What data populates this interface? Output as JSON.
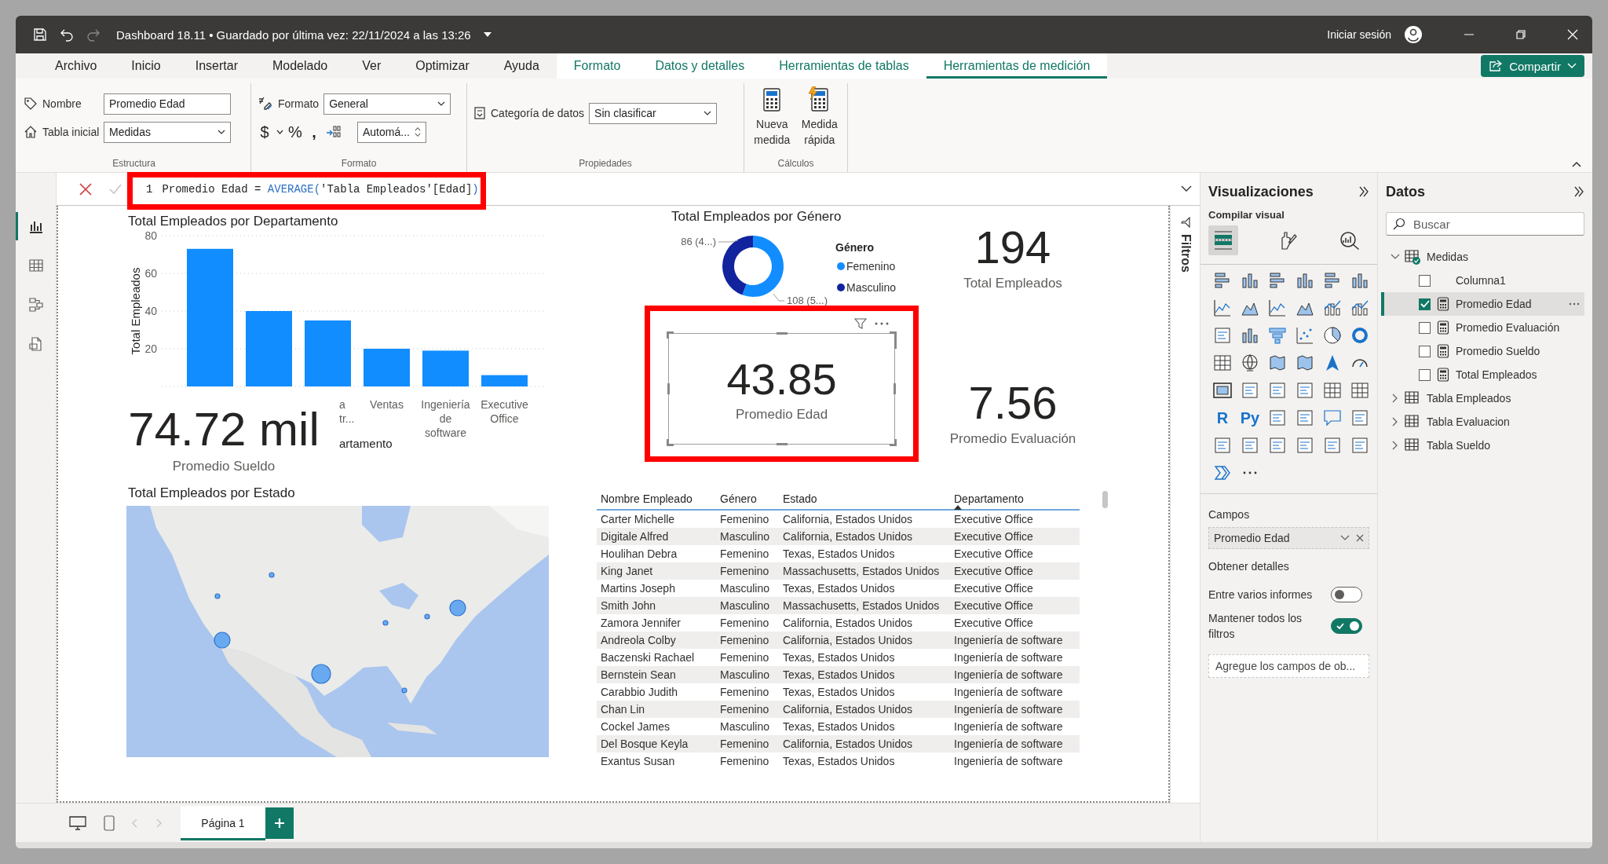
{
  "window": {
    "title": "Dashboard 18.11 • Guardado por última vez: 22/11/2024 a las 13:26",
    "sign_in": "Iniciar sesión"
  },
  "ribbon_tabs": [
    {
      "label": "Archivo",
      "contextual": false,
      "selected": false
    },
    {
      "label": "Inicio",
      "contextual": false,
      "selected": false
    },
    {
      "label": "Insertar",
      "contextual": false,
      "selected": false
    },
    {
      "label": "Modelado",
      "contextual": false,
      "selected": false
    },
    {
      "label": "Ver",
      "contextual": false,
      "selected": false
    },
    {
      "label": "Optimizar",
      "contextual": false,
      "selected": false
    },
    {
      "label": "Ayuda",
      "contextual": false,
      "selected": false
    },
    {
      "label": "Formato",
      "contextual": true,
      "selected": false
    },
    {
      "label": "Datos y detalles",
      "contextual": true,
      "selected": false
    },
    {
      "label": "Herramientas de tablas",
      "contextual": true,
      "selected": false
    },
    {
      "label": "Herramientas de medición",
      "contextual": true,
      "selected": true
    }
  ],
  "share_button": "Compartir",
  "ribbon": {
    "structure": {
      "group": "Estructura",
      "name_label": "Nombre",
      "name_value": "Promedio Edad",
      "home_table_label": "Tabla inicial",
      "home_table_value": "Medidas"
    },
    "formatting": {
      "group": "Formato",
      "format_label": "Formato",
      "format_value": "General",
      "symbols": [
        "$",
        "%",
        ","
      ],
      "decimals_value": "Automá..."
    },
    "properties": {
      "group": "Propiedades",
      "category_label": "Categoría de datos",
      "category_value": "Sin clasificar"
    },
    "calculations": {
      "group": "Cálculos",
      "buttons": [
        {
          "label": "Nueva medida",
          "kind": "new"
        },
        {
          "label": "Medida rápida",
          "kind": "quick"
        }
      ]
    }
  },
  "formula_bar": {
    "line_number": "1",
    "tokens": [
      {
        "text": "Promedio Edad = ",
        "kind": "plain"
      },
      {
        "text": "AVERAGE(",
        "kind": "function"
      },
      {
        "text": "'Tabla Empleados'[Edad]",
        "kind": "plain"
      },
      {
        "text": ")",
        "kind": "function"
      }
    ]
  },
  "left_rail": [
    {
      "kind": "report",
      "selected": true
    },
    {
      "kind": "table",
      "selected": false
    },
    {
      "kind": "model",
      "selected": false
    },
    {
      "kind": "dax",
      "selected": false
    }
  ],
  "report": {
    "bar_chart": {
      "chart_data": {
        "type": "bar",
        "title": "Total Empleados por Departamento",
        "xlabel": "artamento",
        "ylabel": "Total Empleados",
        "categories": [
          null,
          null,
          "a tr...",
          "Ventas",
          "Ingeniería de software",
          "Executive Office"
        ],
        "values": [
          73,
          40,
          35,
          20,
          19,
          6
        ],
        "ylim": [
          0,
          80
        ],
        "yticks": [
          20,
          40,
          60,
          80
        ],
        "grid": true,
        "color": "#118dff"
      }
    },
    "donut_chart": {
      "chart_data": {
        "type": "donut",
        "title": "Total Empleados por Género",
        "categories": [
          "Femenino",
          "Masculino"
        ],
        "colors": [
          "#118dff",
          "#12239e"
        ],
        "values": [
          108,
          86
        ],
        "value_labels": [
          "108 (5...)",
          "86 (4...)"
        ],
        "legend": {
          "title": "Género"
        }
      }
    },
    "cards": [
      {
        "value": "74.72 mil",
        "label": "Promedio Sueldo",
        "selected": false
      },
      {
        "value": "194",
        "label": "Total Empleados",
        "selected": false
      },
      {
        "value": "43.85",
        "label": "Promedio Edad",
        "selected": true
      },
      {
        "value": "7.56",
        "label": "Promedio Evaluación",
        "selected": false
      }
    ],
    "map": {
      "title": "Total Empleados por Estado",
      "kind": "picture"
    },
    "table": {
      "columns": [
        {
          "label": "Nombre Empleado",
          "sorted": false
        },
        {
          "label": "Género",
          "sorted": false
        },
        {
          "label": "Estado",
          "sorted": false
        },
        {
          "label": "Departamento",
          "sorted": true
        }
      ],
      "rows": [
        [
          "Carter Michelle",
          "Femenino",
          "California, Estados Unidos",
          "Executive Office"
        ],
        [
          "Digitale Alfred",
          "Masculino",
          "California, Estados Unidos",
          "Executive Office"
        ],
        [
          "Houlihan Debra",
          "Femenino",
          "Texas, Estados Unidos",
          "Executive Office"
        ],
        [
          "King Janet",
          "Femenino",
          "Massachusetts, Estados Unidos",
          "Executive Office"
        ],
        [
          "Martins Joseph",
          "Masculino",
          "Texas, Estados Unidos",
          "Executive Office"
        ],
        [
          "Smith John",
          "Masculino",
          "Massachusetts, Estados Unidos",
          "Executive Office"
        ],
        [
          "Zamora Jennifer",
          "Femenino",
          "California, Estados Unidos",
          "Executive Office"
        ],
        [
          "Andreola Colby",
          "Femenino",
          "California, Estados Unidos",
          "Ingeniería de software"
        ],
        [
          "Baczenski Rachael",
          "Femenino",
          "Texas, Estados Unidos",
          "Ingeniería de software"
        ],
        [
          "Bernstein Sean",
          "Masculino",
          "Texas, Estados Unidos",
          "Ingeniería de software"
        ],
        [
          "Carabbio Judith",
          "Femenino",
          "Texas, Estados Unidos",
          "Ingeniería de software"
        ],
        [
          "Chan Lin",
          "Femenino",
          "California, Estados Unidos",
          "Ingeniería de software"
        ],
        [
          "Cockel James",
          "Masculino",
          "Texas, Estados Unidos",
          "Ingeniería de software"
        ],
        [
          "Del Bosque Keyla",
          "Femenino",
          "California, Estados Unidos",
          "Ingeniería de software"
        ],
        [
          "Exantus Susan",
          "Femenino",
          "Texas, Estados Unidos",
          "Ingeniería de software"
        ]
      ]
    }
  },
  "filters_pane": {
    "label": "Filtros"
  },
  "visualizations": {
    "title": "Visualizaciones",
    "subtitle": "Compilar visual",
    "build_modes": [
      {
        "kind": "fields",
        "selected": true
      },
      {
        "kind": "format",
        "selected": false
      },
      {
        "kind": "analytics",
        "selected": false
      }
    ],
    "script_visuals": [
      "R",
      "Py"
    ],
    "fields_title": "Campos",
    "field": "Promedio Edad",
    "details_title": "Obtener detalles",
    "toggles": [
      {
        "label": "Entre varios informes",
        "on": false
      },
      {
        "label": "Mantener todos los filtros",
        "on": true
      }
    ],
    "drill_placeholder": "Agregue los campos de ob..."
  },
  "data_pane": {
    "title": "Datos",
    "search": {
      "placeholder": "Buscar"
    },
    "tree": [
      {
        "label": "Medidas",
        "expanded": true,
        "children": [
          {
            "label": "Columna1",
            "kind": "column",
            "checked": false,
            "selected": false
          },
          {
            "label": "Promedio Edad",
            "kind": "measure",
            "checked": true,
            "selected": true
          },
          {
            "label": "Promedio Evaluación",
            "kind": "measure",
            "checked": false,
            "selected": false
          },
          {
            "label": "Promedio Sueldo",
            "kind": "measure",
            "checked": false,
            "selected": false
          },
          {
            "label": "Total Empleados",
            "kind": "measure",
            "checked": false,
            "selected": false
          }
        ]
      },
      {
        "label": "Tabla Empleados",
        "expanded": false
      },
      {
        "label": "Tabla Evaluacion",
        "expanded": false
      },
      {
        "label": "Tabla Sueldo",
        "expanded": false
      }
    ]
  },
  "pages": [
    {
      "label": "Página 1",
      "selected": true
    }
  ]
}
